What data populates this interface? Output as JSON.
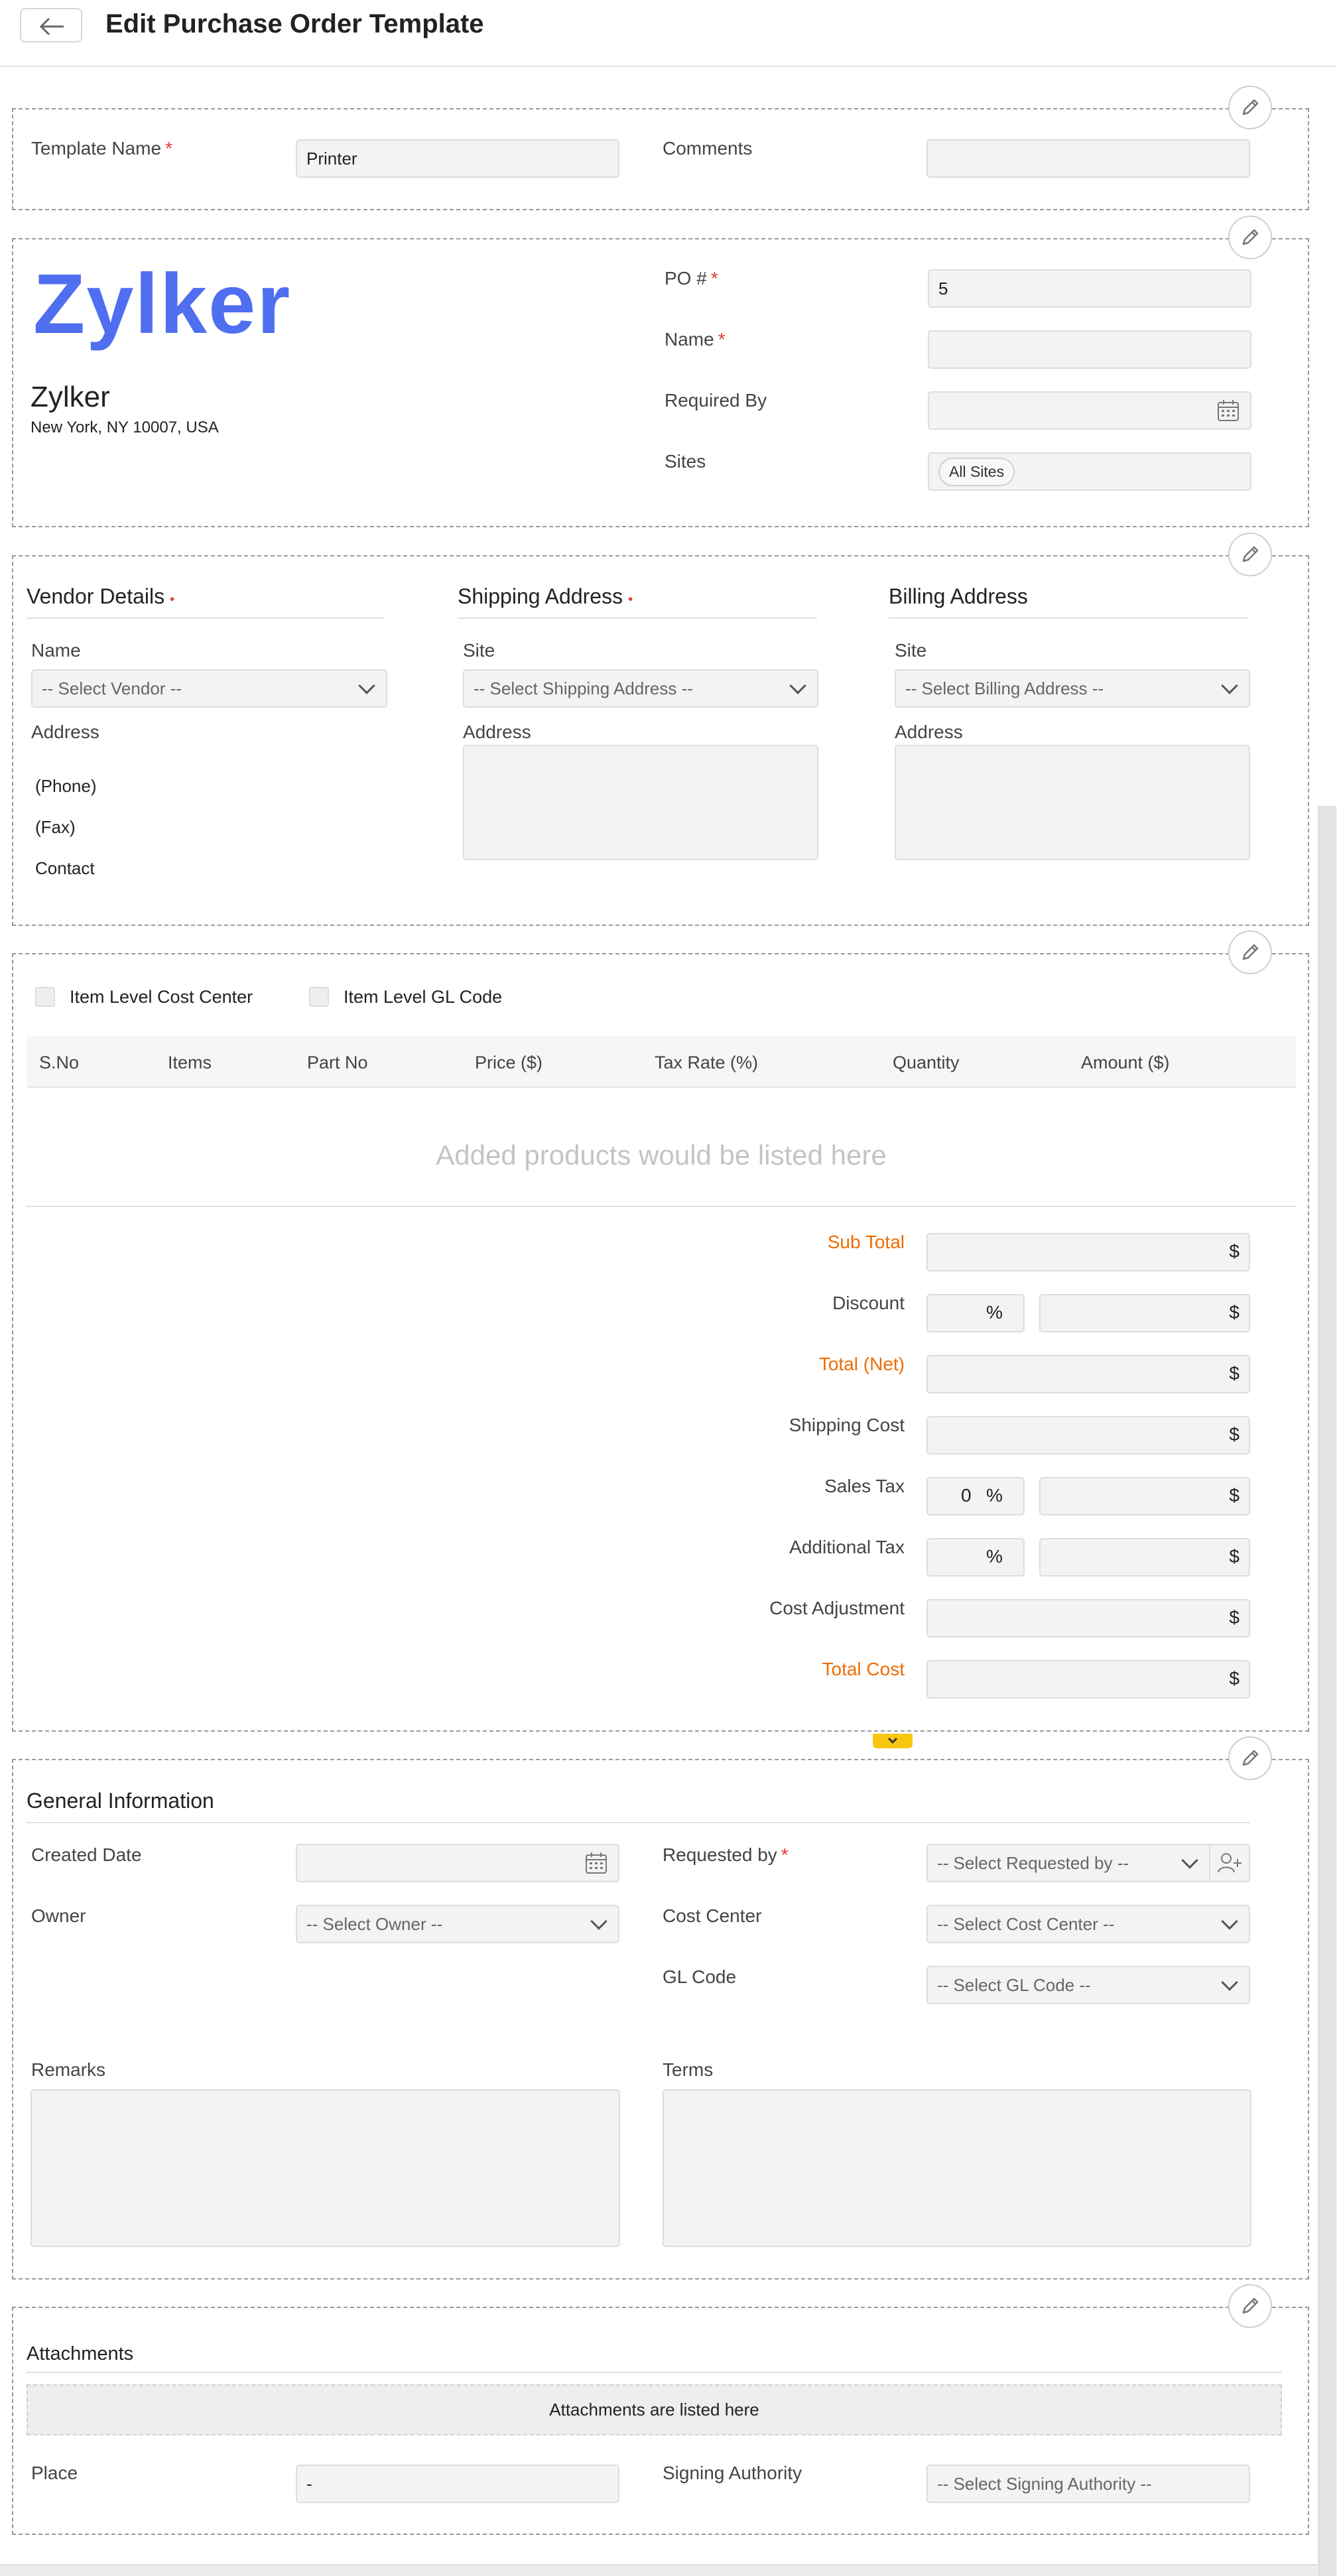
{
  "header": {
    "title": "Edit Purchase Order Template"
  },
  "template_section": {
    "template_name_label": "Template Name",
    "template_name_value": "Printer",
    "comments_label": "Comments",
    "comments_value": ""
  },
  "company": {
    "logo_text": "Zylker",
    "name": "Zylker",
    "address": "New York, NY 10007, USA",
    "logo_color": "#4f6ef0"
  },
  "po_fields": {
    "po_label": "PO #",
    "po_value": "5",
    "name_label": "Name",
    "name_value": "",
    "required_by_label": "Required By",
    "sites_label": "Sites",
    "sites_chip": "All Sites"
  },
  "vendor": {
    "title": "Vendor Details",
    "name_label": "Name",
    "select_placeholder": "-- Select Vendor --",
    "address_label": "Address",
    "phone": "(Phone)",
    "fax": "(Fax)",
    "contact": "Contact"
  },
  "shipping": {
    "title": "Shipping Address",
    "site_label": "Site",
    "select_placeholder": "-- Select Shipping Address --",
    "address_label": "Address"
  },
  "billing": {
    "title": "Billing Address",
    "site_label": "Site",
    "select_placeholder": "-- Select Billing Address --",
    "address_label": "Address"
  },
  "items": {
    "cost_center_checkbox": "Item Level Cost Center",
    "gl_code_checkbox": "Item Level GL Code",
    "columns": [
      "S.No",
      "Items",
      "Part No",
      "Price ($)",
      "Tax Rate (%)",
      "Quantity",
      "Amount ($)"
    ],
    "empty_message": "Added products would be listed here"
  },
  "totals": {
    "sub_total": "Sub Total",
    "discount": "Discount",
    "total_net": "Total (Net)",
    "shipping_cost": "Shipping Cost",
    "sales_tax": "Sales Tax",
    "sales_tax_value": "0",
    "additional_tax": "Additional Tax",
    "cost_adjustment": "Cost Adjustment",
    "total_cost": "Total Cost",
    "currency_symbol": "$",
    "percent_symbol": "%",
    "accent_color": "#ef6c00"
  },
  "general": {
    "title": "General Information",
    "created_date_label": "Created Date",
    "owner_label": "Owner",
    "owner_placeholder": "-- Select Owner --",
    "requested_by_label": "Requested by",
    "requested_by_placeholder": "-- Select Requested by --",
    "cost_center_label": "Cost Center",
    "cost_center_placeholder": "-- Select Cost Center --",
    "gl_code_label": "GL Code",
    "gl_code_placeholder": "-- Select GL Code --",
    "remarks_label": "Remarks",
    "terms_label": "Terms"
  },
  "attachments": {
    "title": "Attachments",
    "empty_message": "Attachments are listed here",
    "place_label": "Place",
    "place_value": "-",
    "signing_authority_label": "Signing Authority",
    "signing_authority_placeholder": "-- Select Signing Authority --"
  },
  "icons": {
    "back": "arrow-left-icon",
    "edit": "pencil-icon",
    "calendar": "calendar-icon",
    "add_user": "add-user-icon",
    "collapse": "chevron-down-icon"
  }
}
